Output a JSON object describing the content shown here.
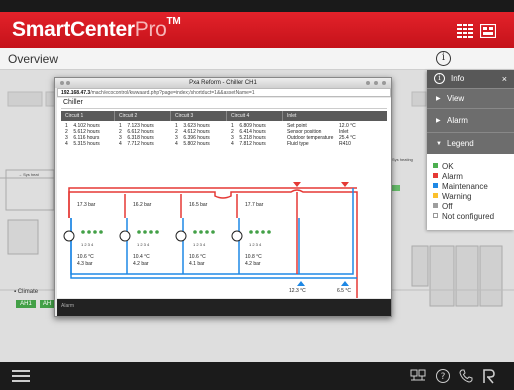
{
  "app": {
    "brand_main": "SmartCenter",
    "brand_pro": "Pro",
    "brand_tm": "TM",
    "page_title": "Overview"
  },
  "popup": {
    "window_title": "Pxa Reform - Chiller CH1",
    "address_host": "192.168.47.3",
    "address_path": "/mach/ecocontrol/kwwaard.php?page=index;/shortduct=1&&assetName=1",
    "heading": "Chiller",
    "tabs": [
      "Circuit 1",
      "Circuit 2",
      "Circuit 3",
      "Circuit 4",
      "Inlet"
    ],
    "circuits": [
      {
        "rows": [
          "1    4.102 hours",
          "2    5.612 hours",
          "3    6.116 hours",
          "4    5.315 hours"
        ],
        "pressure_high": "17.3 bar",
        "temp": "10.6 °C",
        "pressure_low": "4.3 bar"
      },
      {
        "rows": [
          "1    7.123 hours",
          "2    6.612 hours",
          "3    6.318 hours",
          "4    7.712 hours"
        ],
        "pressure_high": "16.2 bar",
        "temp": "10.4 °C",
        "pressure_low": "4.2 bar"
      },
      {
        "rows": [
          "1    3.623 hours",
          "2    4.612 hours",
          "3    6.396 hours",
          "4    5.802 hours"
        ],
        "pressure_high": "16.5 bar",
        "temp": "10.6 °C",
        "pressure_low": "4.1 bar"
      },
      {
        "rows": [
          "1    6.809 hours",
          "2    6.414 hours",
          "3    5.218 hours",
          "4    7.812 hours"
        ],
        "pressure_high": "17.7 bar",
        "temp": "10.8 °C",
        "pressure_low": "4.2 bar"
      }
    ],
    "inlet_rows": [
      {
        "label": "Set point",
        "value": "12.0 °C"
      },
      {
        "label": "Sensor position",
        "value": "Inlet"
      },
      {
        "label": "Outdoor temperature",
        "value": "25.4 °C"
      },
      {
        "label": "Fluid type",
        "value": "R410"
      }
    ],
    "compressor_labels": "1 2 3 4",
    "outlet_temp_left": "12.3 °C",
    "outlet_temp_right": "6.5 °C",
    "footer": "Alarm"
  },
  "background": {
    "climate_label": "▪ Climate",
    "ah1": "AH1",
    "ah2": "AH",
    "label_left": "→ Sys heat",
    "label_right": "Sys heating"
  },
  "info_panel": {
    "title": "Info",
    "close": "×",
    "sections": [
      {
        "label": "View",
        "arrow": "▶"
      },
      {
        "label": "Alarm",
        "arrow": "▶"
      },
      {
        "label": "Legend",
        "arrow": "▼"
      }
    ],
    "legend": [
      {
        "label": "OK",
        "color": "#4caf50"
      },
      {
        "label": "Alarm",
        "color": "#e53935"
      },
      {
        "label": "Maintenance",
        "color": "#1e88e5"
      },
      {
        "label": "Warning",
        "color": "#fbc02d"
      },
      {
        "label": "Off",
        "color": "#9e9e9e"
      },
      {
        "label": "Not configured",
        "color": "#ffffff"
      }
    ]
  },
  "colors": {
    "brand_red": "#d81b22",
    "hot_pipe": "#e53935",
    "cold_pipe": "#1e88e5"
  }
}
